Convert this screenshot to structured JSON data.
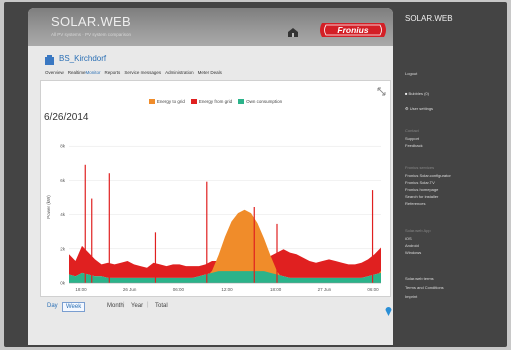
{
  "header": {
    "brand": "SOLAR.WEB",
    "subtitle": "All PV systems · PV system comparison",
    "logo_text": "Fronius"
  },
  "site": {
    "name": "BS_Kirchdorf"
  },
  "nav": {
    "items": [
      {
        "label": "Overview",
        "active": false
      },
      {
        "label": "Realtime",
        "active": false
      },
      {
        "label": "Monitor",
        "active": true
      },
      {
        "label": "Reports",
        "active": false
      },
      {
        "label": "Service messages",
        "active": false
      },
      {
        "label": "Administration",
        "active": false
      },
      {
        "label": "Meter Deals",
        "active": false
      }
    ]
  },
  "chart_data": {
    "type": "area",
    "date_label": "6/26/2014",
    "ylabel": "Power (kW)",
    "yticks": [
      "8k",
      "6k",
      "4k",
      "2k",
      "0k"
    ],
    "xticks": [
      "18:00",
      "26 Jun",
      "06:00",
      "12:00",
      "18:00",
      "27 Jun",
      "06:00"
    ],
    "x_hours": [
      12,
      13,
      14,
      15,
      16,
      17,
      18,
      19,
      20,
      21,
      22,
      23,
      24,
      25,
      26,
      27,
      28,
      29,
      30,
      31,
      32,
      33,
      34,
      35,
      36,
      37,
      38,
      39,
      40,
      41,
      42,
      43,
      44,
      45,
      46,
      47,
      48,
      49,
      50,
      51,
      52,
      53,
      54,
      55,
      56,
      57,
      58,
      59,
      60
    ],
    "series": [
      {
        "name": "Energy to grid",
        "color": "#f08c2a",
        "values": [
          0,
          0,
          0,
          0,
          0,
          0,
          0,
          0,
          0,
          0,
          0,
          0,
          0,
          0,
          0,
          0,
          0,
          0,
          0,
          0,
          0,
          200,
          600,
          1500,
          2600,
          3500,
          4000,
          4200,
          4000,
          3400,
          2500,
          1500,
          600,
          100,
          0,
          0,
          0,
          0,
          0,
          0,
          0,
          0,
          0,
          0,
          0,
          0,
          0,
          200,
          600
        ]
      },
      {
        "name": "Energy from grid",
        "color": "#e02020",
        "values": [
          1200,
          900,
          1600,
          1300,
          1000,
          700,
          900,
          800,
          900,
          1000,
          800,
          700,
          600,
          900,
          800,
          700,
          800,
          800,
          700,
          700,
          600,
          600,
          700,
          600,
          500,
          400,
          300,
          300,
          400,
          500,
          800,
          1000,
          1300,
          1600,
          1500,
          1400,
          1200,
          1000,
          900,
          1000,
          1100,
          1000,
          900,
          800,
          800,
          900,
          1000,
          1200,
          1500
        ]
      },
      {
        "name": "Own consumption",
        "color": "#2bb38a",
        "values": [
          500,
          400,
          600,
          500,
          400,
          400,
          300,
          300,
          300,
          300,
          300,
          300,
          300,
          300,
          300,
          300,
          300,
          300,
          300,
          300,
          400,
          500,
          600,
          700,
          700,
          700,
          700,
          700,
          700,
          700,
          700,
          600,
          500,
          400,
          300,
          300,
          300,
          300,
          300,
          300,
          300,
          300,
          300,
          300,
          300,
          300,
          400,
          500,
          600
        ]
      }
    ],
    "ylim": [
      0,
      9000
    ],
    "grid": true,
    "legend_position": "top-center"
  },
  "period_tabs": [
    "Day",
    "Week",
    "Month",
    "Year",
    "Total"
  ],
  "period_selected": "Week",
  "sidebar": {
    "title": "SOLAR.WEB",
    "logout": "Logout",
    "bubbles": "Bubbles (0)",
    "user_settings": "User settings",
    "contact_head": "Contact",
    "contact_items": [
      "Support",
      "Feedback"
    ],
    "fronius_head": "Fronius services",
    "fronius_items": [
      "Fronius Solar.configurator",
      "Fronius Solar.TV",
      "Fronius homepage",
      "Search for installer",
      "References"
    ],
    "apps_head": "Solar.web App",
    "apps_items": [
      "iOS",
      "Android",
      "Windows"
    ],
    "footer_items": [
      "Solar.web terms",
      "Terms and Conditions",
      "Imprint"
    ]
  }
}
